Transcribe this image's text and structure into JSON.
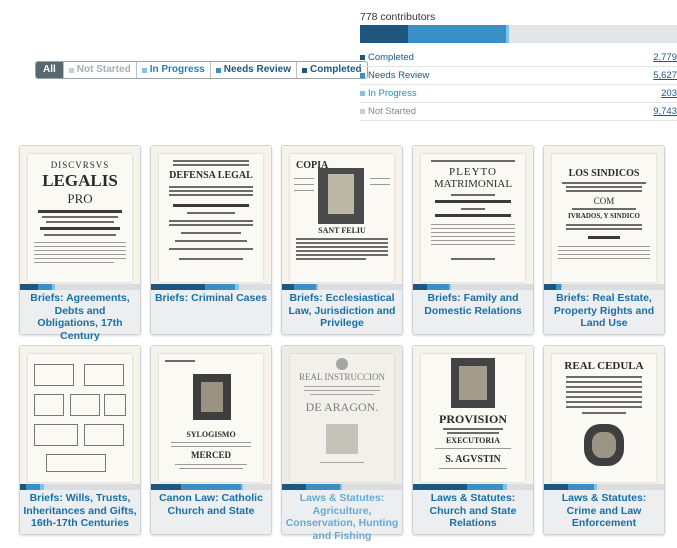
{
  "filters": [
    {
      "label": "All",
      "active": true
    },
    {
      "label": "Not Started"
    },
    {
      "label": "In Progress"
    },
    {
      "label": "Needs Review"
    },
    {
      "label": "Completed"
    }
  ],
  "stats": {
    "contributors": "778 contributors",
    "bar": [
      {
        "status": "completed",
        "fraction": 0.15,
        "color": "#1f567e"
      },
      {
        "status": "needs_review",
        "fraction": 0.31,
        "color": "#3b8fc4"
      },
      {
        "status": "in_progress",
        "fraction": 0.011,
        "color": "#7fc3ea"
      },
      {
        "status": "not_started",
        "fraction": 0.529,
        "color": "#e3e5e6"
      }
    ],
    "rows": [
      {
        "label": "Completed",
        "value": "2,779"
      },
      {
        "label": "Needs Review",
        "value": "5,627"
      },
      {
        "label": "In Progress",
        "value": "203"
      },
      {
        "label": "Not Started",
        "value": "9,743"
      }
    ]
  },
  "projects": [
    {
      "title": "Briefs: Agreements, Debts and Obligations, 17th Century",
      "progress": [
        0.15,
        0.12,
        0.02
      ],
      "thumb": {
        "big": [
          "DISCVRSVS",
          "LEGALIS",
          "PRO"
        ]
      }
    },
    {
      "title": "Briefs: Criminal Cases",
      "progress": [
        0.45,
        0.25,
        0.03
      ],
      "thumb": {
        "big": [
          "DEFENSA LEGAL"
        ]
      }
    },
    {
      "title": "Briefs: Ecclesiastical Law, Jurisdiction and Privilege",
      "progress": [
        0.1,
        0.18,
        0.02
      ],
      "thumb": {
        "big": [
          "COPIA",
          "SANT FELIU"
        ]
      }
    },
    {
      "title": "Briefs: Family and Domestic Relations",
      "progress": [
        0.12,
        0.18,
        0.02
      ],
      "thumb": {
        "big": [
          "PLEYTO",
          "MATRIMONIAL"
        ]
      }
    },
    {
      "title": "Briefs: Real Estate, Property Rights and Land Use",
      "progress": [
        0.1,
        0.04,
        0.01
      ],
      "thumb": {
        "big": [
          "LOS SINDICOS",
          "COM",
          "IVRADOS, Y SINDICO"
        ]
      }
    },
    {
      "title": "Briefs: Wills, Trusts, Inheritances and Gifts, 16th-17th Centuries",
      "progress": [
        0.05,
        0.12,
        0.03
      ],
      "thumb": {
        "big": []
      }
    },
    {
      "title": "Canon Law: Catholic Church and State",
      "progress": [
        0.25,
        0.5,
        0.02
      ],
      "thumb": {
        "big": [
          "SYLOGISMO",
          "MERCED"
        ]
      }
    },
    {
      "title": "Laws & Statutes: Agriculture, Conservation, Hunting and Fishing",
      "light": true,
      "progress": [
        0.2,
        0.28,
        0.02
      ],
      "thumb": {
        "big": [
          "REAL INSTRUCCION",
          "DE ARAGON."
        ]
      }
    },
    {
      "title": "Laws & Statutes: Church and State Relations",
      "progress": [
        0.45,
        0.3,
        0.03
      ],
      "thumb": {
        "big": [
          "PROVISION",
          "EXECUTORIA",
          "S. AGVSTIN"
        ]
      }
    },
    {
      "title": "Laws & Statutes: Crime and Law Enforcement",
      "progress": [
        0.2,
        0.22,
        0.02
      ],
      "thumb": {
        "big": [
          "REAL CEDULA"
        ]
      }
    }
  ],
  "colors": {
    "completed": "#1f567e",
    "needs_review": "#3b8fc4",
    "in_progress": "#7fc3ea",
    "not_started": "#d9dddf"
  }
}
